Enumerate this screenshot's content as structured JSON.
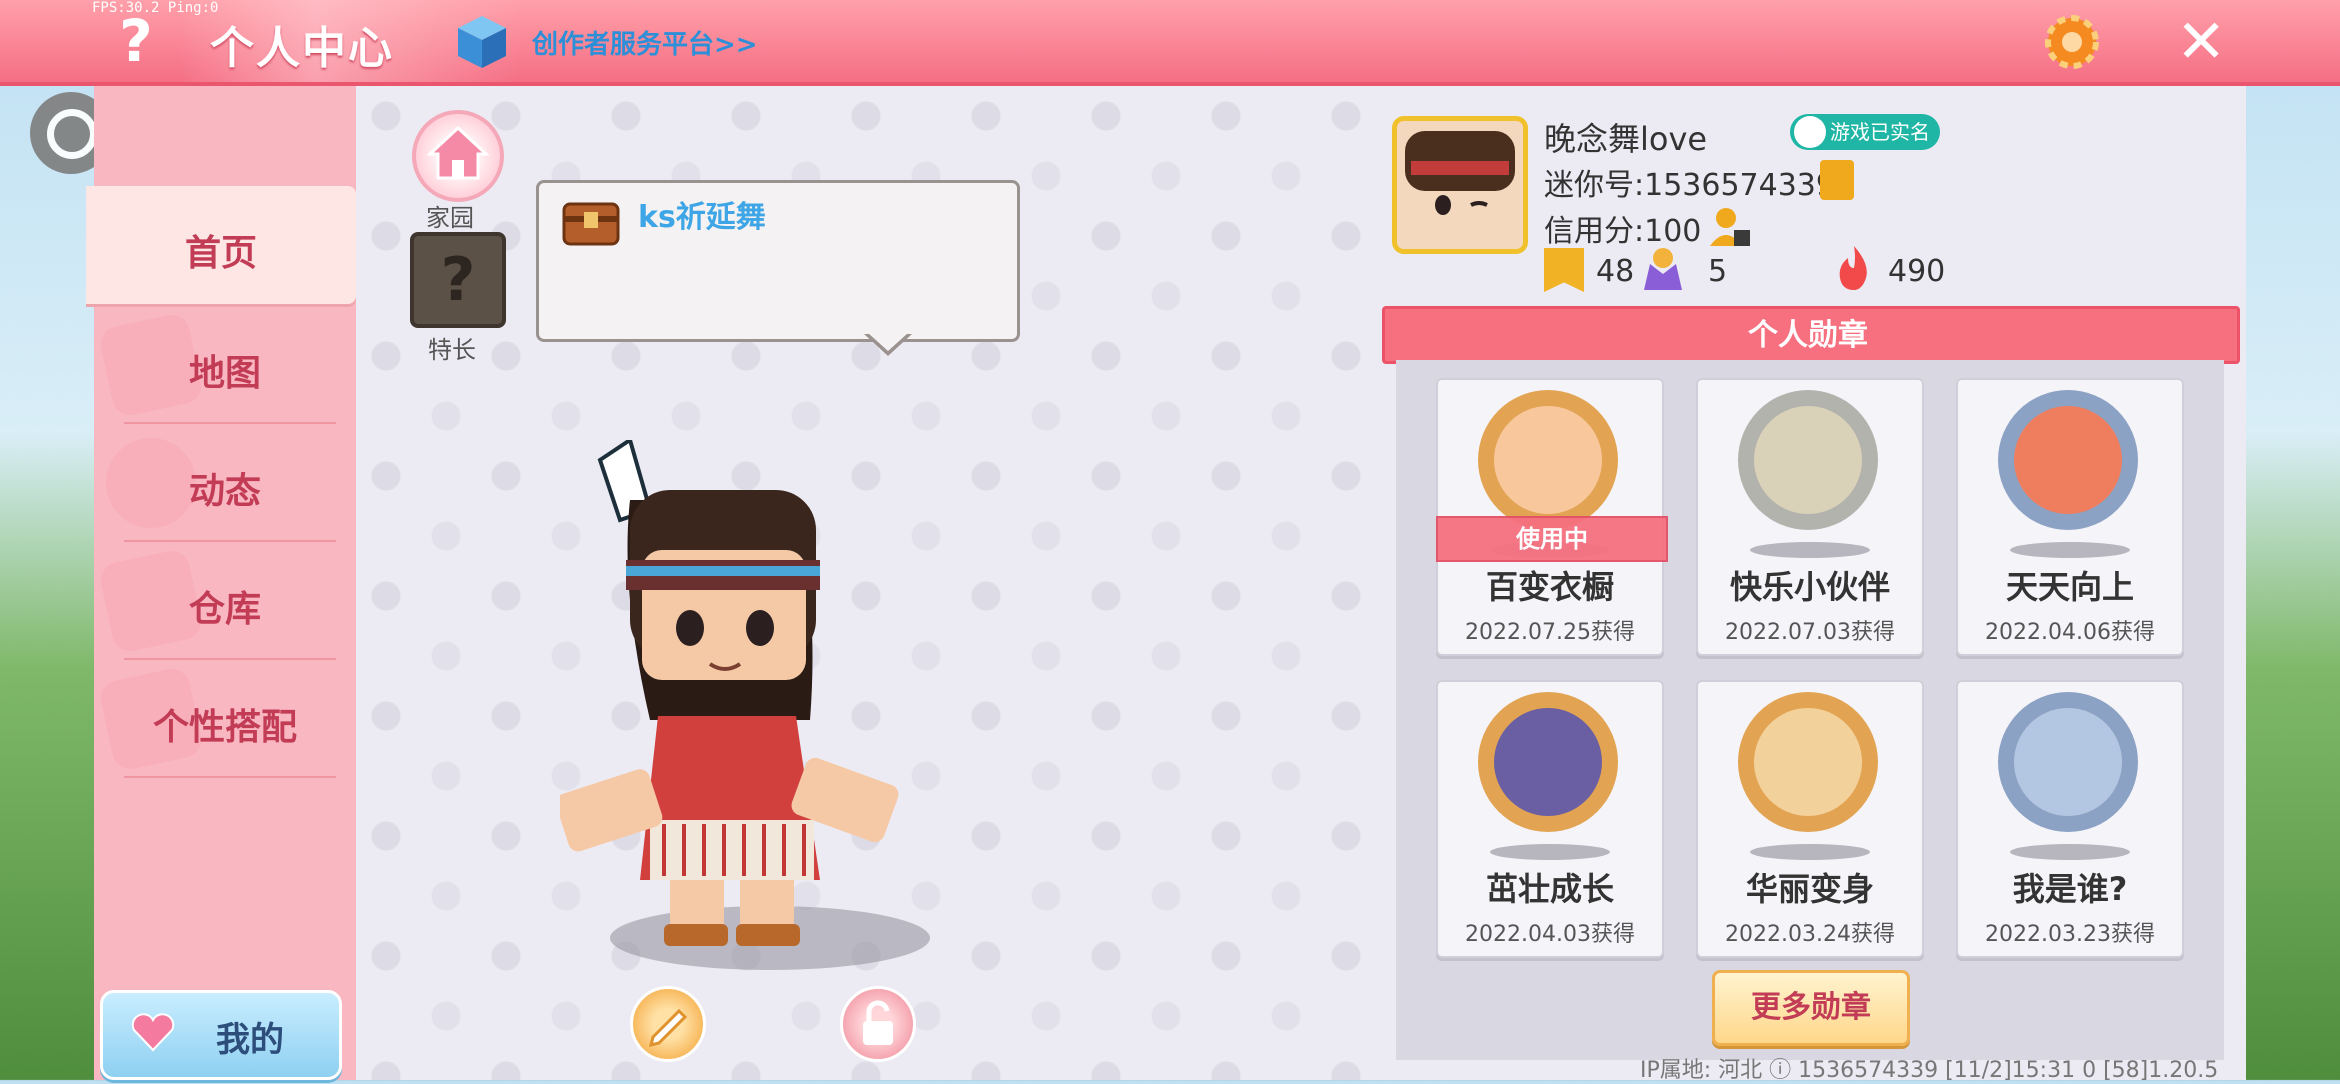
{
  "status": {
    "fps": "FPS:30.2 Ping:0"
  },
  "topbar": {
    "help_symbol": "?",
    "title": "个人中心",
    "creator_link": "创作者服务平台>>",
    "close_symbol": "✕"
  },
  "sidebar": {
    "items": [
      {
        "label": "首页",
        "active": true
      },
      {
        "label": "地图"
      },
      {
        "label": "动态"
      },
      {
        "label": "仓库"
      },
      {
        "label": "个性搭配"
      }
    ],
    "my_button": "我的"
  },
  "center": {
    "home_label": "家园",
    "special_label": "特长",
    "special_symbol": "?",
    "bubble_text": "ks祈延舞"
  },
  "profile": {
    "nickname": "晚念舞love",
    "realname_badge": "游戏已实名",
    "mini_id": "迷你号:1536574339",
    "credit": "信用分:100",
    "stats": {
      "bookmarks": "48",
      "fans": "5",
      "heat": "490"
    }
  },
  "medals": {
    "title": "个人勋章",
    "in_use_label": "使用中",
    "items": [
      {
        "name": "百变衣橱",
        "date": "2022.07.25获得",
        "ring": "#e2a453",
        "fill": "#f8c79c"
      },
      {
        "name": "快乐小伙伴",
        "date": "2022.07.03获得",
        "ring": "#b3b3ae",
        "fill": "#d9d2b8"
      },
      {
        "name": "天天向上",
        "date": "2022.04.06获得",
        "ring": "#8ca2c4",
        "fill": "#ee7e5d"
      },
      {
        "name": "茁壮成长",
        "date": "2022.04.03获得",
        "ring": "#e2a453",
        "fill": "#6a5fa3"
      },
      {
        "name": "华丽变身",
        "date": "2022.03.24获得",
        "ring": "#e2a453",
        "fill": "#f3d19a"
      },
      {
        "name": "我是谁?",
        "date": "2022.03.23获得",
        "ring": "#8ca2c4",
        "fill": "#b4c7e2"
      }
    ],
    "more_button": "更多勋章"
  },
  "footer": {
    "text": "IP属地: 河北 ⓘ     1536574339    [11/2]15:31 0    [58]1.20.5"
  }
}
